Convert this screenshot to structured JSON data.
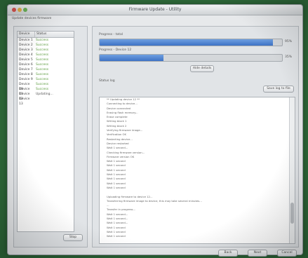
{
  "window": {
    "title": "Firmware Update - Utility",
    "subtitle": "Update devices firmware"
  },
  "left_panel": {
    "columns": [
      "Device",
      "Status"
    ],
    "rows": [
      {
        "device": "Device 1",
        "status": "Success"
      },
      {
        "device": "Device 2",
        "status": "Success"
      },
      {
        "device": "Device 3",
        "status": "Success"
      },
      {
        "device": "Device 4",
        "status": "Success"
      },
      {
        "device": "Device 5",
        "status": "Success"
      },
      {
        "device": "Device 6",
        "status": "Success"
      },
      {
        "device": "Device 7",
        "status": "Success"
      },
      {
        "device": "Device 8",
        "status": "Success"
      },
      {
        "device": "Device 9",
        "status": "Success"
      },
      {
        "device": "Device 10",
        "status": "Success"
      },
      {
        "device": "Device 11",
        "status": "Success"
      },
      {
        "device": "Device 12",
        "status": "Updating..."
      },
      {
        "device": "Device 13",
        "status": ""
      }
    ],
    "button_label": "Stop"
  },
  "right_panel": {
    "progress1": {
      "label": "Progress - total",
      "value": 0.95,
      "pct_text": "95%"
    },
    "progress2": {
      "label": "Progress - Device 12",
      "value": 0.35,
      "pct_text": "35%"
    },
    "details_button": "Hide details",
    "log_label": "Status log",
    "save_log_button": "Save log to file",
    "log_lines": [
      "** Updating device 12 **",
      "Connecting to device...",
      "Device connected",
      "Erasing flash memory...",
      "Erase complete",
      "Writing block 1",
      "Writing block 2",
      "Verifying firmware image...",
      "Verification OK",
      "Restarting device...",
      "Device restarted",
      "Wait 1 second...",
      "Checking firmware version...",
      "Firmware version OK",
      "Wait 1 second",
      "Wait 1 second",
      "Wait 1 second",
      "Wait 1 second",
      "Wait 1 second",
      "Wait 1 second",
      "Wait 1 second",
      "",
      "Uploading firmware to device 12...",
      "Transferring firmware image to device, this may take several minutes...",
      "...",
      "Transfer in progress...",
      "Wait 1 second...",
      "Wait 1 second...",
      "Wait 1 second...",
      "Wait 1 second",
      "Wait 1 second",
      "Wait 1 second"
    ]
  },
  "footer": {
    "back_label": "Back",
    "next_label": "Next",
    "cancel_label": "Cancel"
  }
}
